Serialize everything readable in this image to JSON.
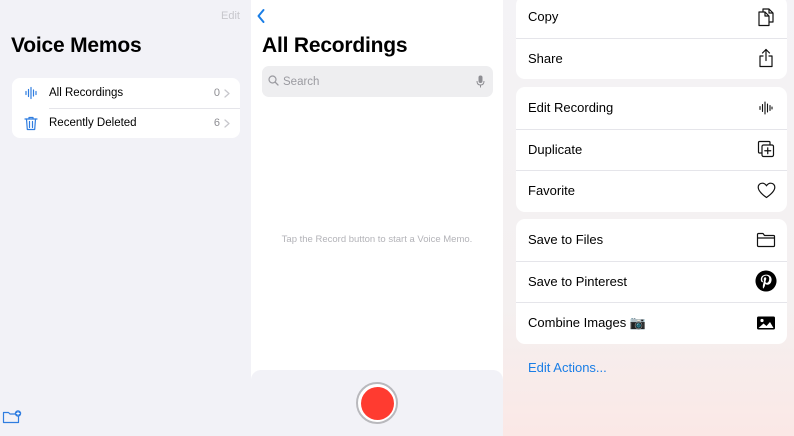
{
  "sidebar": {
    "edit_label": "Edit",
    "title": "Voice Memos",
    "items": [
      {
        "label": "All Recordings",
        "count": "0",
        "icon": "waveform-icon"
      },
      {
        "label": "Recently Deleted",
        "count": "6",
        "icon": "trash-icon"
      }
    ],
    "footer_icon": "new-folder-icon"
  },
  "recordings": {
    "title": "All Recordings",
    "search_placeholder": "Search",
    "empty_message": "Tap the Record button to start a Voice Memo."
  },
  "share_sheet": {
    "groups": [
      [
        {
          "label": "Copy",
          "icon": "copy-icon"
        },
        {
          "label": "Share",
          "icon": "share-icon"
        }
      ],
      [
        {
          "label": "Edit Recording",
          "icon": "waveform-icon"
        },
        {
          "label": "Duplicate",
          "icon": "duplicate-icon"
        },
        {
          "label": "Favorite",
          "icon": "heart-icon"
        }
      ],
      [
        {
          "label": "Save to Files",
          "icon": "folder-icon"
        },
        {
          "label": "Save to Pinterest",
          "icon": "pinterest-icon"
        },
        {
          "label": "Combine Images 📷",
          "icon": "photo-icon"
        }
      ]
    ],
    "edit_actions_label": "Edit Actions..."
  },
  "colors": {
    "accent": "#1a7ee6",
    "record": "#ff3b30",
    "pinterest": "#000000"
  }
}
